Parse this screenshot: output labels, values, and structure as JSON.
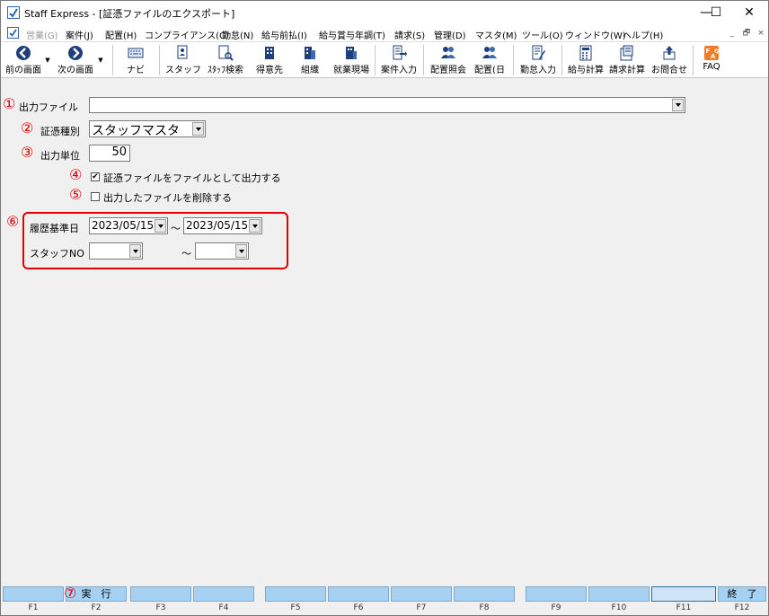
{
  "window": {
    "title": "Staff Express - [証憑ファイルのエクスポート]",
    "controls": {
      "minimize": "—",
      "maximize": "☐",
      "close": "✕"
    }
  },
  "menubar": {
    "items": [
      {
        "label": "営業(G)",
        "disabled": true
      },
      {
        "label": "案件(J)"
      },
      {
        "label": "配置(H)"
      },
      {
        "label": "コンプライアンス(C)"
      },
      {
        "label": "勤怠(N)"
      },
      {
        "label": "給与前払(I)"
      },
      {
        "label": "給与賞与年調(T)"
      },
      {
        "label": "請求(S)"
      },
      {
        "label": "管理(D)"
      },
      {
        "label": "マスタ(M)"
      },
      {
        "label": "ツール(O)"
      },
      {
        "label": "ウィンドウ(W)"
      },
      {
        "label": "ヘルプ(H)"
      }
    ],
    "mdi_controls": [
      "_",
      "🗗",
      "×"
    ]
  },
  "toolbar": {
    "items": [
      {
        "label": "前の画面",
        "icon": "arrow-left-icon"
      },
      {
        "label": "次の画面",
        "icon": "arrow-right-icon"
      },
      {
        "label": "ナビ",
        "icon": "keyboard-icon"
      },
      {
        "label": "スタッフ",
        "icon": "person-icon"
      },
      {
        "label": "ｽﾀｯﾌ検索",
        "icon": "person-search-icon"
      },
      {
        "label": "得意先",
        "icon": "building-icon"
      },
      {
        "label": "組織",
        "icon": "organization-icon"
      },
      {
        "label": "就業現場",
        "icon": "workplace-icon"
      },
      {
        "label": "案件入力",
        "icon": "job-entry-icon"
      },
      {
        "label": "配置照会",
        "icon": "assignment-inquiry-icon"
      },
      {
        "label": "配置(日",
        "icon": "assignment-daily-icon"
      },
      {
        "label": "勤怠入力",
        "icon": "attendance-entry-icon"
      },
      {
        "label": "給与計算",
        "icon": "payroll-calc-icon"
      },
      {
        "label": "請求計算",
        "icon": "billing-calc-icon"
      },
      {
        "label": "お問合せ",
        "icon": "inquiry-icon"
      },
      {
        "label": "FAQ",
        "icon": "faq-icon"
      }
    ]
  },
  "markers": [
    "①",
    "②",
    "③",
    "④",
    "⑤",
    "⑥",
    "⑦"
  ],
  "form": {
    "output_file_label": "出力ファイル",
    "output_file_value": "",
    "evidence_type_label": "証憑種別",
    "evidence_type_value": "スタッフマスタ",
    "output_unit_label": "出力単位",
    "output_unit_value": "50",
    "export_as_file_label": "証憑ファイルをファイルとして出力する",
    "export_as_file_checked": true,
    "delete_output_label": "出力したファイルを削除する",
    "delete_output_checked": false,
    "history_date_label": "履歴基準日",
    "history_date_from": "2023/05/15",
    "history_date_to": "2023/05/15",
    "range_sep": "～",
    "staff_no_label": "スタッフNO",
    "staff_no_from": "",
    "staff_no_to": ""
  },
  "fkeys": [
    {
      "key": "F1",
      "label": ""
    },
    {
      "key": "F2",
      "label": "実　行"
    },
    {
      "key": "F3",
      "label": ""
    },
    {
      "key": "F4",
      "label": ""
    },
    {
      "key": "F5",
      "label": ""
    },
    {
      "key": "F6",
      "label": ""
    },
    {
      "key": "F7",
      "label": ""
    },
    {
      "key": "F8",
      "label": ""
    },
    {
      "key": "F9",
      "label": ""
    },
    {
      "key": "F10",
      "label": ""
    },
    {
      "key": "F11",
      "label": ""
    },
    {
      "key": "F12",
      "label": "終　了"
    }
  ],
  "colors": {
    "annotation_red": "#e00000",
    "fkey_blue": "#a8d0f0"
  }
}
